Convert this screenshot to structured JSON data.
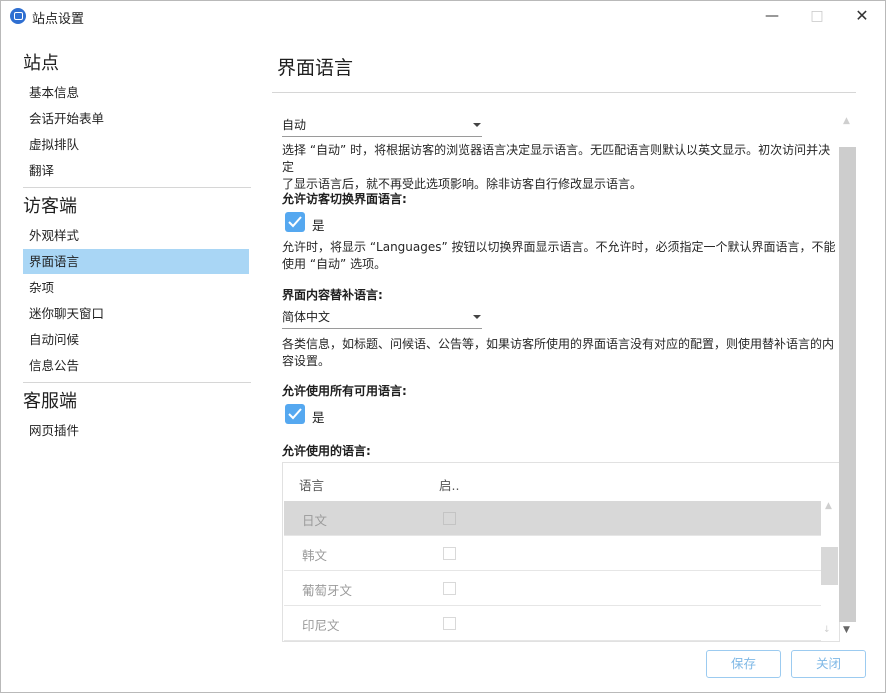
{
  "window": {
    "title": "站点设置"
  },
  "sidebar": {
    "sections": [
      {
        "title": "站点",
        "items": [
          "基本信息",
          "会话开始表单",
          "虚拟排队",
          "翻译"
        ]
      },
      {
        "title": "访客端",
        "items": [
          "外观样式",
          "界面语言",
          "杂项",
          "迷你聊天窗口",
          "自动问候",
          "信息公告"
        ]
      },
      {
        "title": "客服端",
        "items": [
          "网页插件"
        ]
      }
    ],
    "active_item": "界面语言"
  },
  "main": {
    "title": "界面语言",
    "display_language": {
      "value": "自动",
      "desc_line1": "选择 “自动” 时，将根据访客的浏览器语言决定显示语言。无匹配语言则默认以英文显示。初次访问并决定",
      "desc_line2": "了显示语言后，就不再受此选项影响。除非访客自行修改显示语言。"
    },
    "allow_switch": {
      "label": "允许访客切换界面语言:",
      "check_label": "是",
      "checked": true,
      "desc_line1": "允许时，将显示 “Languages” 按钮以切换界面显示语言。不允许时，必须指定一个默认界面语言，不能",
      "desc_line2": "使用 “自动” 选项。"
    },
    "fallback": {
      "label": "界面内容替补语言:",
      "value": "简体中文",
      "desc_line1": "各类信息，如标题、问候语、公告等，如果访客所使用的界面语言没有对应的配置，则使用替补语言的内",
      "desc_line2": "容设置。"
    },
    "allow_all": {
      "label": "允许使用所有可用语言:",
      "check_label": "是",
      "checked": true
    },
    "allowed_languages": {
      "label": "允许使用的语言:",
      "columns": [
        "语言",
        "启.."
      ],
      "rows": [
        "日文",
        "韩文",
        "葡萄牙文",
        "印尼文"
      ],
      "selected_row": "日文"
    }
  },
  "footer": {
    "save": "保存",
    "close": "关闭"
  },
  "colors": {
    "accent": "#55a8f0",
    "active_nav": "#a9d6f5",
    "button_border": "#9ccbf0"
  }
}
